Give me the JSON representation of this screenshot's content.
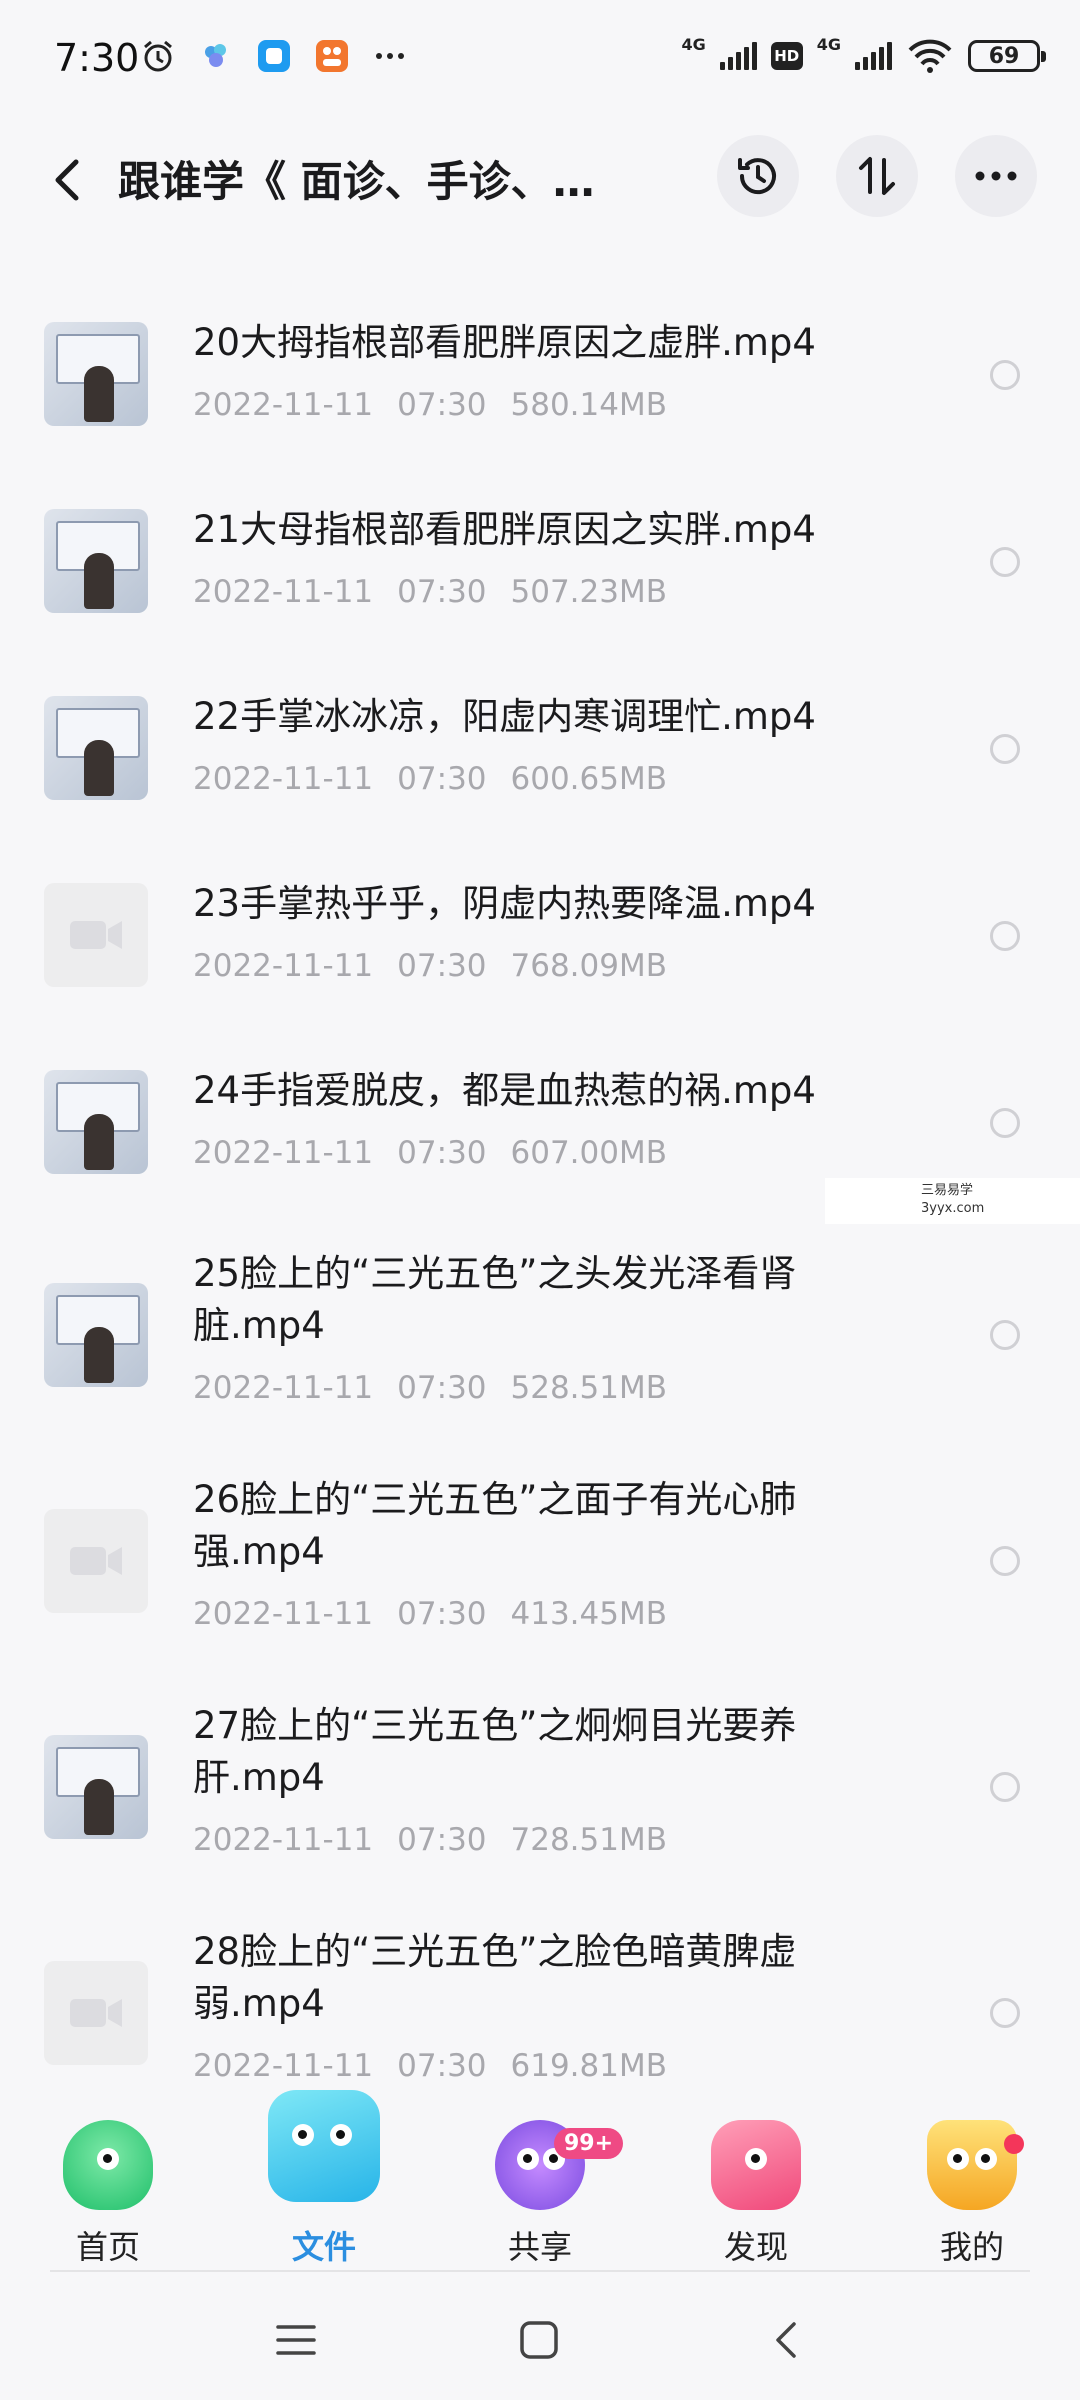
{
  "status_bar": {
    "time": "7:30",
    "net1": "4G",
    "net2": "4G",
    "hd": "HD",
    "battery": "69",
    "icons": [
      "alarm-icon",
      "cloud-app-icon",
      "app-square-icon",
      "app-orange-icon",
      "more-dots-icon"
    ]
  },
  "header": {
    "title": "跟谁学《 面诊、手诊、…",
    "icons": [
      "back-arrow-icon",
      "history-icon",
      "sort-icon",
      "more-icon"
    ]
  },
  "files": [
    {
      "name": "20大拇指根部看肥胖原因之虚胖.mp4",
      "date": "2022-11-11",
      "time": "07:30",
      "size": "580.14MB"
    },
    {
      "name": "21大母指根部看肥胖原因之实胖.mp4",
      "date": "2022-11-11",
      "time": "07:30",
      "size": "507.23MB"
    },
    {
      "name": "22手掌冰冰凉，阳虚内寒调理忙.mp4",
      "date": "2022-11-11",
      "time": "07:30",
      "size": "600.65MB"
    },
    {
      "name": "23手掌热乎乎，阴虚内热要降温.mp4",
      "date": "2022-11-11",
      "time": "07:30",
      "size": "768.09MB"
    },
    {
      "name": "24手指爱脱皮，都是血热惹的祸.mp4",
      "date": "2022-11-11",
      "time": "07:30",
      "size": "607.00MB"
    },
    {
      "name": "25脸上的“三光五色”之头发光泽看肾脏.mp4",
      "date": "2022-11-11",
      "time": "07:30",
      "size": "528.51MB"
    },
    {
      "name": "26脸上的“三光五色”之面子有光心肺强.mp4",
      "date": "2022-11-11",
      "time": "07:30",
      "size": "413.45MB"
    },
    {
      "name": "27脸上的“三光五色”之炯炯目光要养肝.mp4",
      "date": "2022-11-11",
      "time": "07:30",
      "size": "728.51MB"
    },
    {
      "name": "28脸上的“三光五色”之脸色暗黄脾虚弱.mp4",
      "date": "2022-11-11",
      "time": "07:30",
      "size": "619.81MB"
    }
  ],
  "watermark": {
    "line1": "三易易学",
    "line2": "3yyx.com"
  },
  "bottom_nav": {
    "items": [
      {
        "label": "首页",
        "icon": "home-cloud-icon"
      },
      {
        "label": "文件",
        "icon": "files-icon",
        "active": true
      },
      {
        "label": "共享",
        "icon": "share-atom-icon"
      },
      {
        "label": "发现",
        "icon": "discover-hexagon-icon"
      },
      {
        "label": "我的",
        "icon": "profile-cake-icon"
      }
    ],
    "share_badge": "99+"
  },
  "system_nav": {
    "icons": [
      "menu-icon",
      "home-square-icon",
      "back-chevron-icon"
    ]
  },
  "colors": {
    "active_tab": "#2b8ee0",
    "badge": "#ef4a84",
    "meta_text": "#a8a8ad"
  }
}
